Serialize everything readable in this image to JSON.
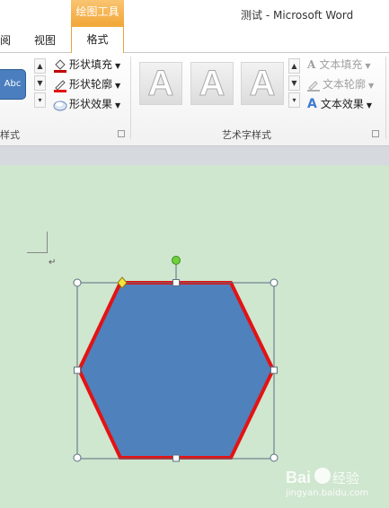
{
  "app": {
    "context_tab": "绘图工具",
    "window_title": "测试 - Microsoft Word"
  },
  "tabs": {
    "review_partial": "阅",
    "view": "视图",
    "format": "格式"
  },
  "ribbon": {
    "shape_styles": {
      "sample_label": "Abc",
      "group_label": "样式",
      "fill": "形状填充",
      "outline": "形状轮廓",
      "effects": "形状效果"
    },
    "wordart_styles": {
      "samples": [
        "A",
        "A",
        "A"
      ],
      "group_label": "艺术字样式",
      "text_fill": "文本填充",
      "text_outline": "文本轮廓",
      "text_effects": "文本效果"
    }
  },
  "document": {
    "paragraph_mark": "↵",
    "shape": {
      "type": "hexagon",
      "fill_color": "#4f81bd",
      "outline_color": "#e31313",
      "selected": true
    }
  },
  "watermark": {
    "brand": "Baidu 经验",
    "url": "jingyan.baidu.com"
  },
  "colors": {
    "context_tab": "#f2a93b",
    "document_bg": "#cfe6cf",
    "ribbon_bg": "#f1f1f1"
  }
}
